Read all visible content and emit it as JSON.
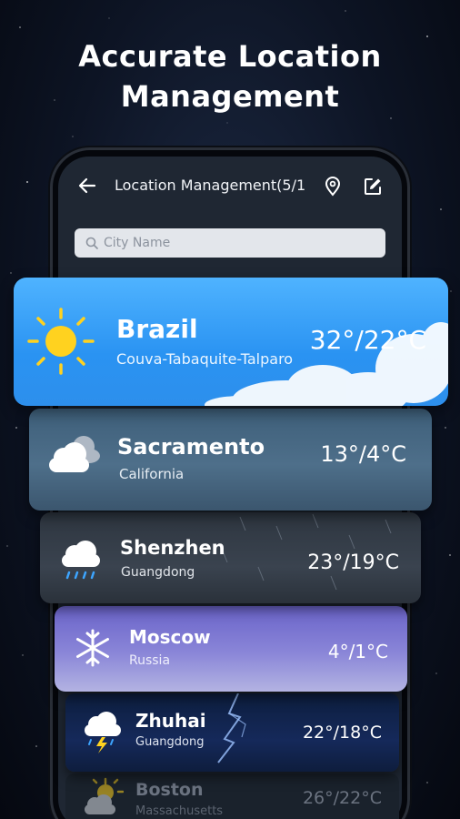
{
  "headline": {
    "line1": "Accurate Location",
    "line2": "Management"
  },
  "appbar": {
    "title": "Location Management(5/1",
    "back_icon": "arrow-left-icon",
    "pin_icon": "location-pin-icon",
    "edit_icon": "edit-icon"
  },
  "search": {
    "placeholder": "City Name",
    "icon": "search-icon"
  },
  "locations": [
    {
      "city": "Brazil",
      "region": "Couva-Tabaquite-Talparo",
      "temp": "32°/22°C",
      "icon": "sun-icon",
      "color": "#2a93f2"
    },
    {
      "city": "Sacramento",
      "region": "California",
      "temp": "13°/4°C",
      "icon": "cloudy-icon",
      "color": "#4e6f8a"
    },
    {
      "city": "Shenzhen",
      "region": "Guangdong",
      "temp": "23°/19°C",
      "icon": "rain-icon",
      "color": "#3a434f"
    },
    {
      "city": "Moscow",
      "region": "Russia",
      "temp": "4°/1°C",
      "icon": "snowflake-icon",
      "color": "#8a86d8"
    },
    {
      "city": "Zhuhai",
      "region": "Guangdong",
      "temp": "22°/18°C",
      "icon": "thunderstorm-icon",
      "color": "#15295a"
    },
    {
      "city": "Boston",
      "region": "Massachusetts",
      "temp": "26°/22°C",
      "icon": "partly-sunny-icon",
      "color": "#1a222c"
    }
  ]
}
